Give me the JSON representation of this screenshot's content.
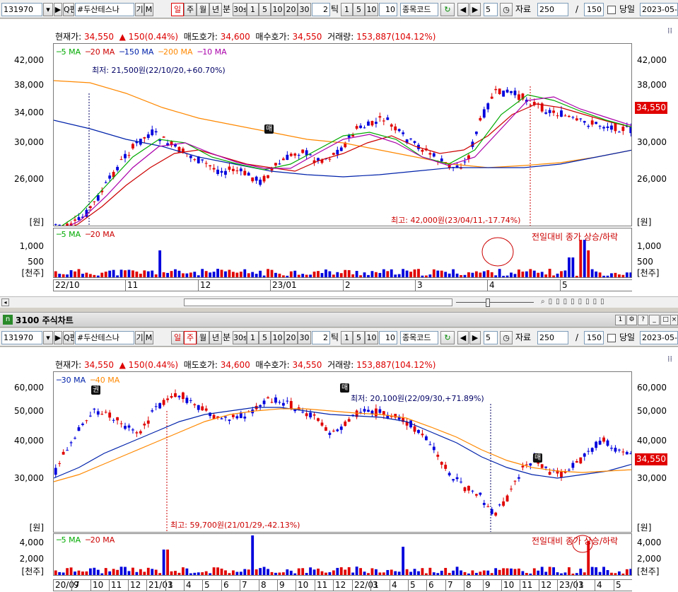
{
  "top": {
    "toolbar": {
      "code": "131970",
      "search_label": "Q펀",
      "name": "#두산테스나",
      "gi_label": "기",
      "m_label": "M",
      "periods": [
        "일",
        "주",
        "월",
        "년",
        "분"
      ],
      "minute_buttons": [
        "30s",
        "1",
        "5",
        "10",
        "20",
        "30"
      ],
      "tick_value": "2",
      "tick_label": "틱",
      "tick_buttons": [
        "1",
        "5",
        "10"
      ],
      "tick_input": "10",
      "stock_code_label": "종목코드",
      "step_value": "5",
      "data_label": "자료",
      "data_count": "250",
      "slash": "/",
      "total": "150",
      "today_label": "당일",
      "date": "2023-05-"
    },
    "info": {
      "current_label": "현재가:",
      "current": "34,550",
      "change": "▲ 150(0.44%)",
      "ask_label": "매도호가:",
      "ask": "34,600",
      "bid_label": "매수호가:",
      "bid": "34,550",
      "volume_label": "거래량:",
      "volume": "153,887(104.12%)"
    },
    "legend": [
      "5 MA",
      "20 MA",
      "150 MA",
      "200 MA",
      "10 MA"
    ],
    "y_ticks": [
      "42,000",
      "38,000",
      "34,000",
      "30,000",
      "26,000"
    ],
    "y_unit": "[원]",
    "price_tag": "34,550",
    "low_annotation": "최저: 21,500원(22/10/20,+60.70%)",
    "high_annotation": "최고: 42,000원(23/04/11,-17.74%)",
    "sell_badge": "매",
    "vol_legend": [
      "5 MA",
      "20 MA"
    ],
    "vol_annotation": "전일대비 종가 상승/하락",
    "vol_ticks": [
      "1,000",
      "500"
    ],
    "vol_unit": "[천주]",
    "dates": [
      "22/10",
      "11",
      "12",
      "23/01",
      "2",
      "3",
      "4",
      "5"
    ]
  },
  "window_title": "3100 주식차트",
  "bottom": {
    "toolbar": {
      "code": "131970",
      "search_label": "Q펀",
      "name": "#두산테스나",
      "gi_label": "기",
      "m_label": "M",
      "periods": [
        "일",
        "주",
        "월",
        "년",
        "분"
      ],
      "minute_buttons": [
        "30s",
        "1",
        "5",
        "10",
        "20",
        "30"
      ],
      "tick_value": "2",
      "tick_label": "틱",
      "tick_buttons": [
        "1",
        "5",
        "10"
      ],
      "tick_input": "10",
      "stock_code_label": "종목코드",
      "step_value": "5",
      "data_label": "자료",
      "data_count": "250",
      "slash": "/",
      "total": "150",
      "today_label": "당일",
      "date": "2023-05-"
    },
    "info": {
      "current_label": "현재가:",
      "current": "34,550",
      "change": "▲ 150(0.44%)",
      "ask_label": "매도호가:",
      "ask": "34,600",
      "bid_label": "매수호가:",
      "bid": "34,550",
      "volume_label": "거래량:",
      "volume": "153,887(104.12%)"
    },
    "legend": [
      "30 MA",
      "40 MA"
    ],
    "y_ticks": [
      "60,000",
      "50,000",
      "40,000",
      "30,000"
    ],
    "y_unit": "[원]",
    "price_tag": "34,550",
    "low_annotation": "최저: 20,100원(22/09/30,+71.89%)",
    "high_annotation": "최고: 59,700원(21/01/29,-42.13%)",
    "badges": [
      "권",
      "매",
      "매"
    ],
    "vol_legend": [
      "5 MA",
      "20 MA"
    ],
    "vol_annotation": "전일대비 종가 상승/하락",
    "vol_ticks": [
      "4,000",
      "2,000"
    ],
    "vol_unit": "[천주]",
    "dates": [
      "20/07",
      "9",
      "10",
      "11",
      "12",
      "21/01",
      "3",
      "4",
      "5",
      "6",
      "7",
      "8",
      "9",
      "10",
      "11",
      "12",
      "22/01",
      "3",
      "4",
      "5",
      "6",
      "7",
      "8",
      "9",
      "10",
      "11",
      "12",
      "23/01",
      "3",
      "4",
      "5"
    ]
  },
  "colors": {
    "ma5": "#00aa00",
    "ma20": "#cc0000",
    "ma150": "#0022aa",
    "ma200": "#ff8800",
    "ma10": "#aa00aa",
    "ma30": "#0022aa",
    "ma40": "#ff8800",
    "up": "#e00000",
    "down": "#0000dd"
  }
}
